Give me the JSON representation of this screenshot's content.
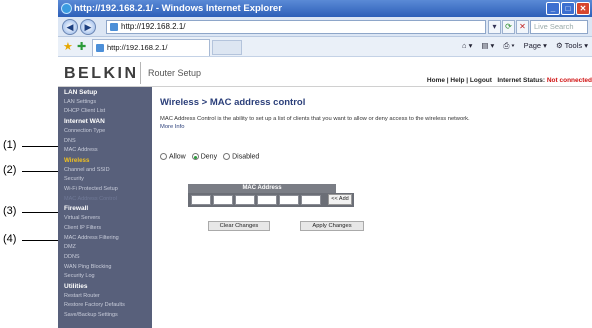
{
  "callouts": [
    "(1)",
    "(2)",
    "(3)",
    "(4)"
  ],
  "window": {
    "title": "http://192.168.2.1/ - Windows Internet Explorer",
    "address": "http://192.168.2.1/",
    "search_placeholder": "Live Search",
    "tab_label": "http://192.168.2.1/",
    "page_menu": "Page",
    "tools_menu": "Tools"
  },
  "header": {
    "logo": "BELKIN",
    "section": "Router Setup",
    "links": "Home | Help | Logout",
    "status_label": "Internet Status:",
    "status_value": "Not connected"
  },
  "sidebar": {
    "items": [
      {
        "label": "LAN Setup",
        "kind": "head"
      },
      {
        "label": "LAN Settings",
        "kind": "item"
      },
      {
        "label": "DHCP Client List",
        "kind": "item"
      },
      {
        "label": "Internet WAN",
        "kind": "head"
      },
      {
        "label": "Connection Type",
        "kind": "item"
      },
      {
        "label": "DNS",
        "kind": "item"
      },
      {
        "label": "MAC Address",
        "kind": "item"
      },
      {
        "label": "Wireless",
        "kind": "active"
      },
      {
        "label": "Channel and SSID",
        "kind": "item"
      },
      {
        "label": "Security",
        "kind": "item"
      },
      {
        "label": "Wi-Fi Protected Setup",
        "kind": "item"
      },
      {
        "label": "MAC Address Control",
        "kind": "current"
      },
      {
        "label": "Firewall",
        "kind": "head"
      },
      {
        "label": "Virtual Servers",
        "kind": "item"
      },
      {
        "label": "Client IP Filters",
        "kind": "item"
      },
      {
        "label": "MAC Address Filtering",
        "kind": "item"
      },
      {
        "label": "DMZ",
        "kind": "item"
      },
      {
        "label": "DDNS",
        "kind": "item"
      },
      {
        "label": "WAN Ping Blocking",
        "kind": "item"
      },
      {
        "label": "Security Log",
        "kind": "item"
      },
      {
        "label": "Utilities",
        "kind": "head"
      },
      {
        "label": "Restart Router",
        "kind": "item"
      },
      {
        "label": "Restore Factory Defaults",
        "kind": "item"
      },
      {
        "label": "Save/Backup Settings",
        "kind": "item"
      }
    ]
  },
  "main": {
    "title": "Wireless > MAC address control",
    "description": "MAC Address Control is the ability to set up a list of clients that you want to allow or deny access to the wireless network.",
    "more_info": "More Info",
    "radios": [
      {
        "label": "Allow",
        "checked": false
      },
      {
        "label": "Deny",
        "checked": true
      },
      {
        "label": "Disabled",
        "checked": false
      }
    ],
    "mac_header": "MAC Address",
    "add_button": "<< Add",
    "clear_button": "Clear Changes",
    "apply_button": "Apply Changes"
  },
  "colors": {
    "sidebar_bg": "#58607b",
    "active_item": "#f0c020",
    "title_blue": "#2b3f7a",
    "status_red": "#d01010"
  }
}
